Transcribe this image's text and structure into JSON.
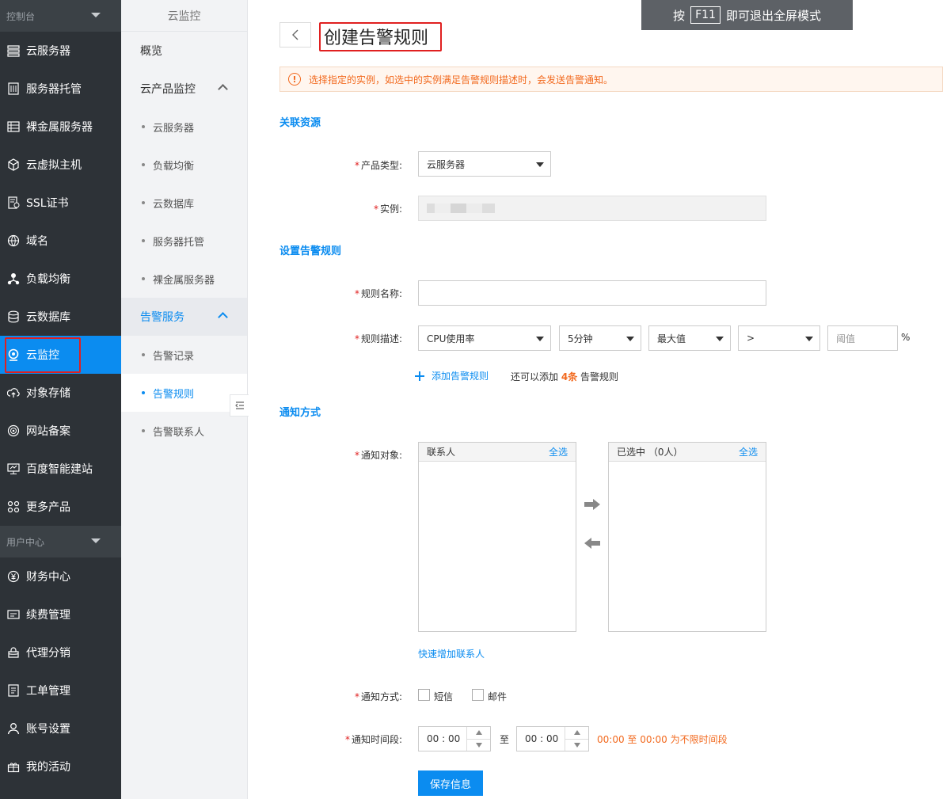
{
  "sidebar": {
    "section1": "控制台",
    "items": [
      {
        "label": "云服务器",
        "icon": "server-icon"
      },
      {
        "label": "服务器托管",
        "icon": "hosting-icon"
      },
      {
        "label": "裸金属服务器",
        "icon": "baremetal-icon"
      },
      {
        "label": "云虚拟主机",
        "icon": "cube-icon"
      },
      {
        "label": "SSL证书",
        "icon": "certificate-icon"
      },
      {
        "label": "域名",
        "icon": "globe-icon"
      },
      {
        "label": "负载均衡",
        "icon": "balance-icon"
      },
      {
        "label": "云数据库",
        "icon": "database-icon"
      },
      {
        "label": "云监控",
        "icon": "monitor-icon",
        "active": true
      },
      {
        "label": "对象存储",
        "icon": "cloud-upload-icon"
      },
      {
        "label": "网站备案",
        "icon": "record-icon"
      },
      {
        "label": "百度智能建站",
        "icon": "desktop-icon"
      },
      {
        "label": "更多产品",
        "icon": "grid-icon"
      }
    ],
    "section2": "用户中心",
    "items2": [
      {
        "label": "财务中心",
        "icon": "yen-icon"
      },
      {
        "label": "续费管理",
        "icon": "renew-icon"
      },
      {
        "label": "代理分销",
        "icon": "agent-icon"
      },
      {
        "label": "工单管理",
        "icon": "ticket-icon"
      },
      {
        "label": "账号设置",
        "icon": "user-icon"
      },
      {
        "label": "我的活动",
        "icon": "gift-icon"
      }
    ]
  },
  "subnav": {
    "title": "云监控",
    "overview": "概览",
    "group1": "云产品监控",
    "group1_items": [
      "云服务器",
      "负载均衡",
      "云数据库",
      "服务器托管",
      "裸金属服务器"
    ],
    "group2": "告警服务",
    "group2_items": [
      "告警记录",
      "告警规则",
      "告警联系人"
    ]
  },
  "main": {
    "page_title": "创建告警规则",
    "fullscreen_hint_pre": "按",
    "fullscreen_hint_key": "F11",
    "fullscreen_hint_post": "即可退出全屏模式",
    "notice": "选择指定的实例，如选中的实例满足告警规则描述时，会发送告警通知。",
    "section_resource": "关联资源",
    "product_type_label": "产品类型:",
    "product_type_value": "云服务器",
    "instance_label": "实例:",
    "section_rule": "设置告警规则",
    "rule_name_label": "规则名称:",
    "rule_desc_label": "规则描述:",
    "metric": "CPU使用率",
    "period": "5分钟",
    "stat": "最大值",
    "operator": ">",
    "threshold_placeholder": "阈值",
    "percent": "%",
    "add_rule": "添加告警规则",
    "can_add_pre": "还可以添加",
    "can_add_count": "4条",
    "can_add_post": "告警规则",
    "section_notify": "通知方式",
    "notify_target_label": "通知对象:",
    "contacts_header": "联系人",
    "select_all": "全选",
    "selected_header": "已选中 （0人）",
    "quick_add_contact": "快速增加联系人",
    "notify_method_label": "通知方式:",
    "sms": "短信",
    "email": "邮件",
    "notify_time_label": "通知时间段:",
    "time_start": "00 : 00",
    "time_to": "至",
    "time_end": "00 : 00",
    "time_hint": "00:00 至 00:00 为不限时间段",
    "save": "保存信息"
  }
}
